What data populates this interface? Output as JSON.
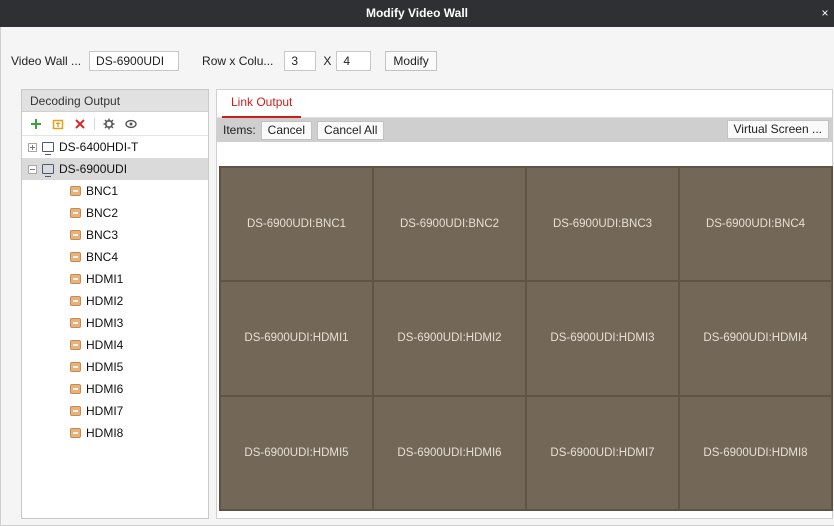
{
  "window": {
    "title": "Modify Video Wall",
    "close_glyph": "×"
  },
  "form": {
    "name_label": "Video Wall ...",
    "name_value": "DS-6900UDI",
    "rowcol_label": "Row x Colu...",
    "rows_value": "3",
    "x_label": "X",
    "cols_value": "4",
    "modify_label": "Modify"
  },
  "decoding_output": {
    "header": "Decoding Output",
    "toolbar_icons": [
      "add-icon",
      "import-icon",
      "delete-icon",
      "settings-icon",
      "view-icon"
    ],
    "devices": [
      {
        "name": "DS-6400HDI-T",
        "expanded": false,
        "selected": false,
        "channels": []
      },
      {
        "name": "DS-6900UDI",
        "expanded": true,
        "selected": true,
        "channels": [
          "BNC1",
          "BNC2",
          "BNC3",
          "BNC4",
          "HDMI1",
          "HDMI2",
          "HDMI3",
          "HDMI4",
          "HDMI5",
          "HDMI6",
          "HDMI7",
          "HDMI8"
        ]
      }
    ]
  },
  "link_output": {
    "tab_label": "Link Output",
    "items_label": "Items:",
    "cancel_label": "Cancel",
    "cancel_all_label": "Cancel All",
    "virtual_screen_label": "Virtual Screen ..."
  },
  "wall": {
    "rows": 3,
    "cols": 4,
    "cells": [
      "DS-6900UDI:BNC1",
      "DS-6900UDI:BNC2",
      "DS-6900UDI:BNC3",
      "DS-6900UDI:BNC4",
      "DS-6900UDI:HDMI1",
      "DS-6900UDI:HDMI2",
      "DS-6900UDI:HDMI3",
      "DS-6900UDI:HDMI4",
      "DS-6900UDI:HDMI5",
      "DS-6900UDI:HDMI6",
      "DS-6900UDI:HDMI7",
      "DS-6900UDI:HDMI8"
    ]
  },
  "colors": {
    "titlebar": "#2f3033",
    "accent_red": "#c81e1e",
    "wall_cell": "#736757",
    "wall_text": "#e7e0d4",
    "add_icon": "#3aa53a",
    "import_icon": "#e0a21c",
    "delete_icon": "#d42a2a"
  }
}
